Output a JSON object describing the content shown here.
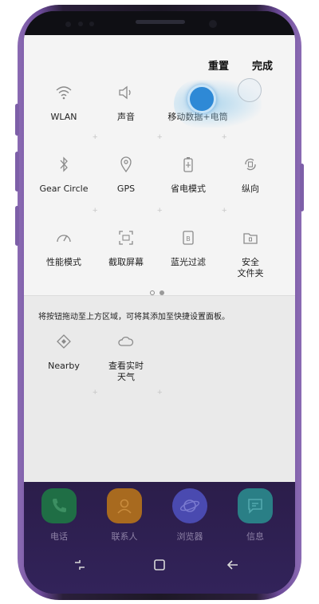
{
  "header": {
    "reset_label": "重置",
    "done_label": "完成"
  },
  "tiles": [
    {
      "label": "WLAN",
      "icon": "wifi-icon"
    },
    {
      "label": "声音",
      "icon": "sound-icon"
    },
    {
      "label": "移动数据+电筒",
      "icon": "mobile-data-icon"
    },
    {
      "label": "Gear Circle",
      "icon": "bluetooth-icon"
    },
    {
      "label": "GPS",
      "icon": "location-icon"
    },
    {
      "label": "省电模式",
      "icon": "battery-saver-icon"
    },
    {
      "label": "纵向",
      "icon": "rotate-icon"
    },
    {
      "label": "性能模式",
      "icon": "performance-icon"
    },
    {
      "label": "截取屏幕",
      "icon": "screenshot-icon"
    },
    {
      "label": "蓝光过滤",
      "icon": "blue-light-icon"
    },
    {
      "label": "安全\n文件夹",
      "icon": "secure-folder-icon"
    }
  ],
  "hint": "将按钮拖动至上方区域，可将其添加至快捷设置面板。",
  "available_tiles": [
    {
      "label": "Nearby",
      "icon": "nearby-icon"
    },
    {
      "label": "查看实时\n天气",
      "icon": "weather-icon"
    }
  ],
  "page_indicator": {
    "pages": 2,
    "current": 1
  },
  "dock": [
    {
      "label": "电话",
      "icon": "phone-icon",
      "color": "#1f9e57"
    },
    {
      "label": "联系人",
      "icon": "contacts-icon",
      "color": "#f08a1c"
    },
    {
      "label": "浏览器",
      "icon": "browser-icon",
      "color": "#5b5fd6"
    },
    {
      "label": "信息",
      "icon": "message-icon",
      "color": "#2fb3b1"
    }
  ],
  "nav": {
    "recent": "recent-apps-icon",
    "home": "home-icon",
    "back": "back-icon"
  },
  "colors": {
    "accent": "#2e89d6",
    "frame": "#6c4a98"
  }
}
